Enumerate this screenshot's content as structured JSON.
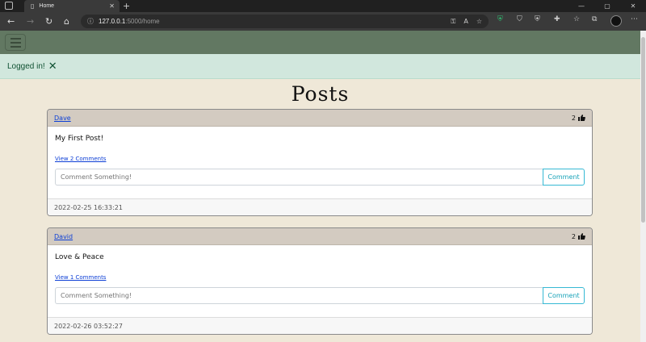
{
  "browser": {
    "tab_title": "Home",
    "url_host": "127.0.0.1",
    "url_path": ":5000/home",
    "tab_close": "✕",
    "new_tab": "+",
    "window_buttons": [
      "—",
      "▢",
      "✕"
    ]
  },
  "icons": {
    "back": "←",
    "forward": "→",
    "reload": "↻",
    "home": "⌂",
    "info": "ⓘ",
    "key": "⚿",
    "read_aloud": "A",
    "favorite_add": "☆",
    "favorites": "☆",
    "collections": "⧉",
    "extensions": "⚙",
    "menu": "⋯",
    "tracking": "⛉",
    "shield": "⛨",
    "puzzle": "✚"
  },
  "flash": {
    "message": "Logged in!",
    "close": "✕"
  },
  "page": {
    "heading": "Posts"
  },
  "posts": [
    {
      "author": "Dave",
      "likes": "2",
      "text": "My First Post!",
      "view_comments": "View 2 Comments",
      "comment_placeholder": "Comment Something!",
      "comment_button": "Comment",
      "date": "2022-02-25 16:33:21"
    },
    {
      "author": "David",
      "likes": "2",
      "text": "Love & Peace",
      "view_comments": "View 1 Comments",
      "comment_placeholder": "Comment Something!",
      "comment_button": "Comment",
      "date": "2022-02-26 03:52:27"
    }
  ],
  "colors": {
    "navbar": "#627862",
    "page_bg": "#efe8d8",
    "alert_bg": "#d1e7dd",
    "card_header": "#d3cbc1",
    "accent": "#17a2b8"
  }
}
